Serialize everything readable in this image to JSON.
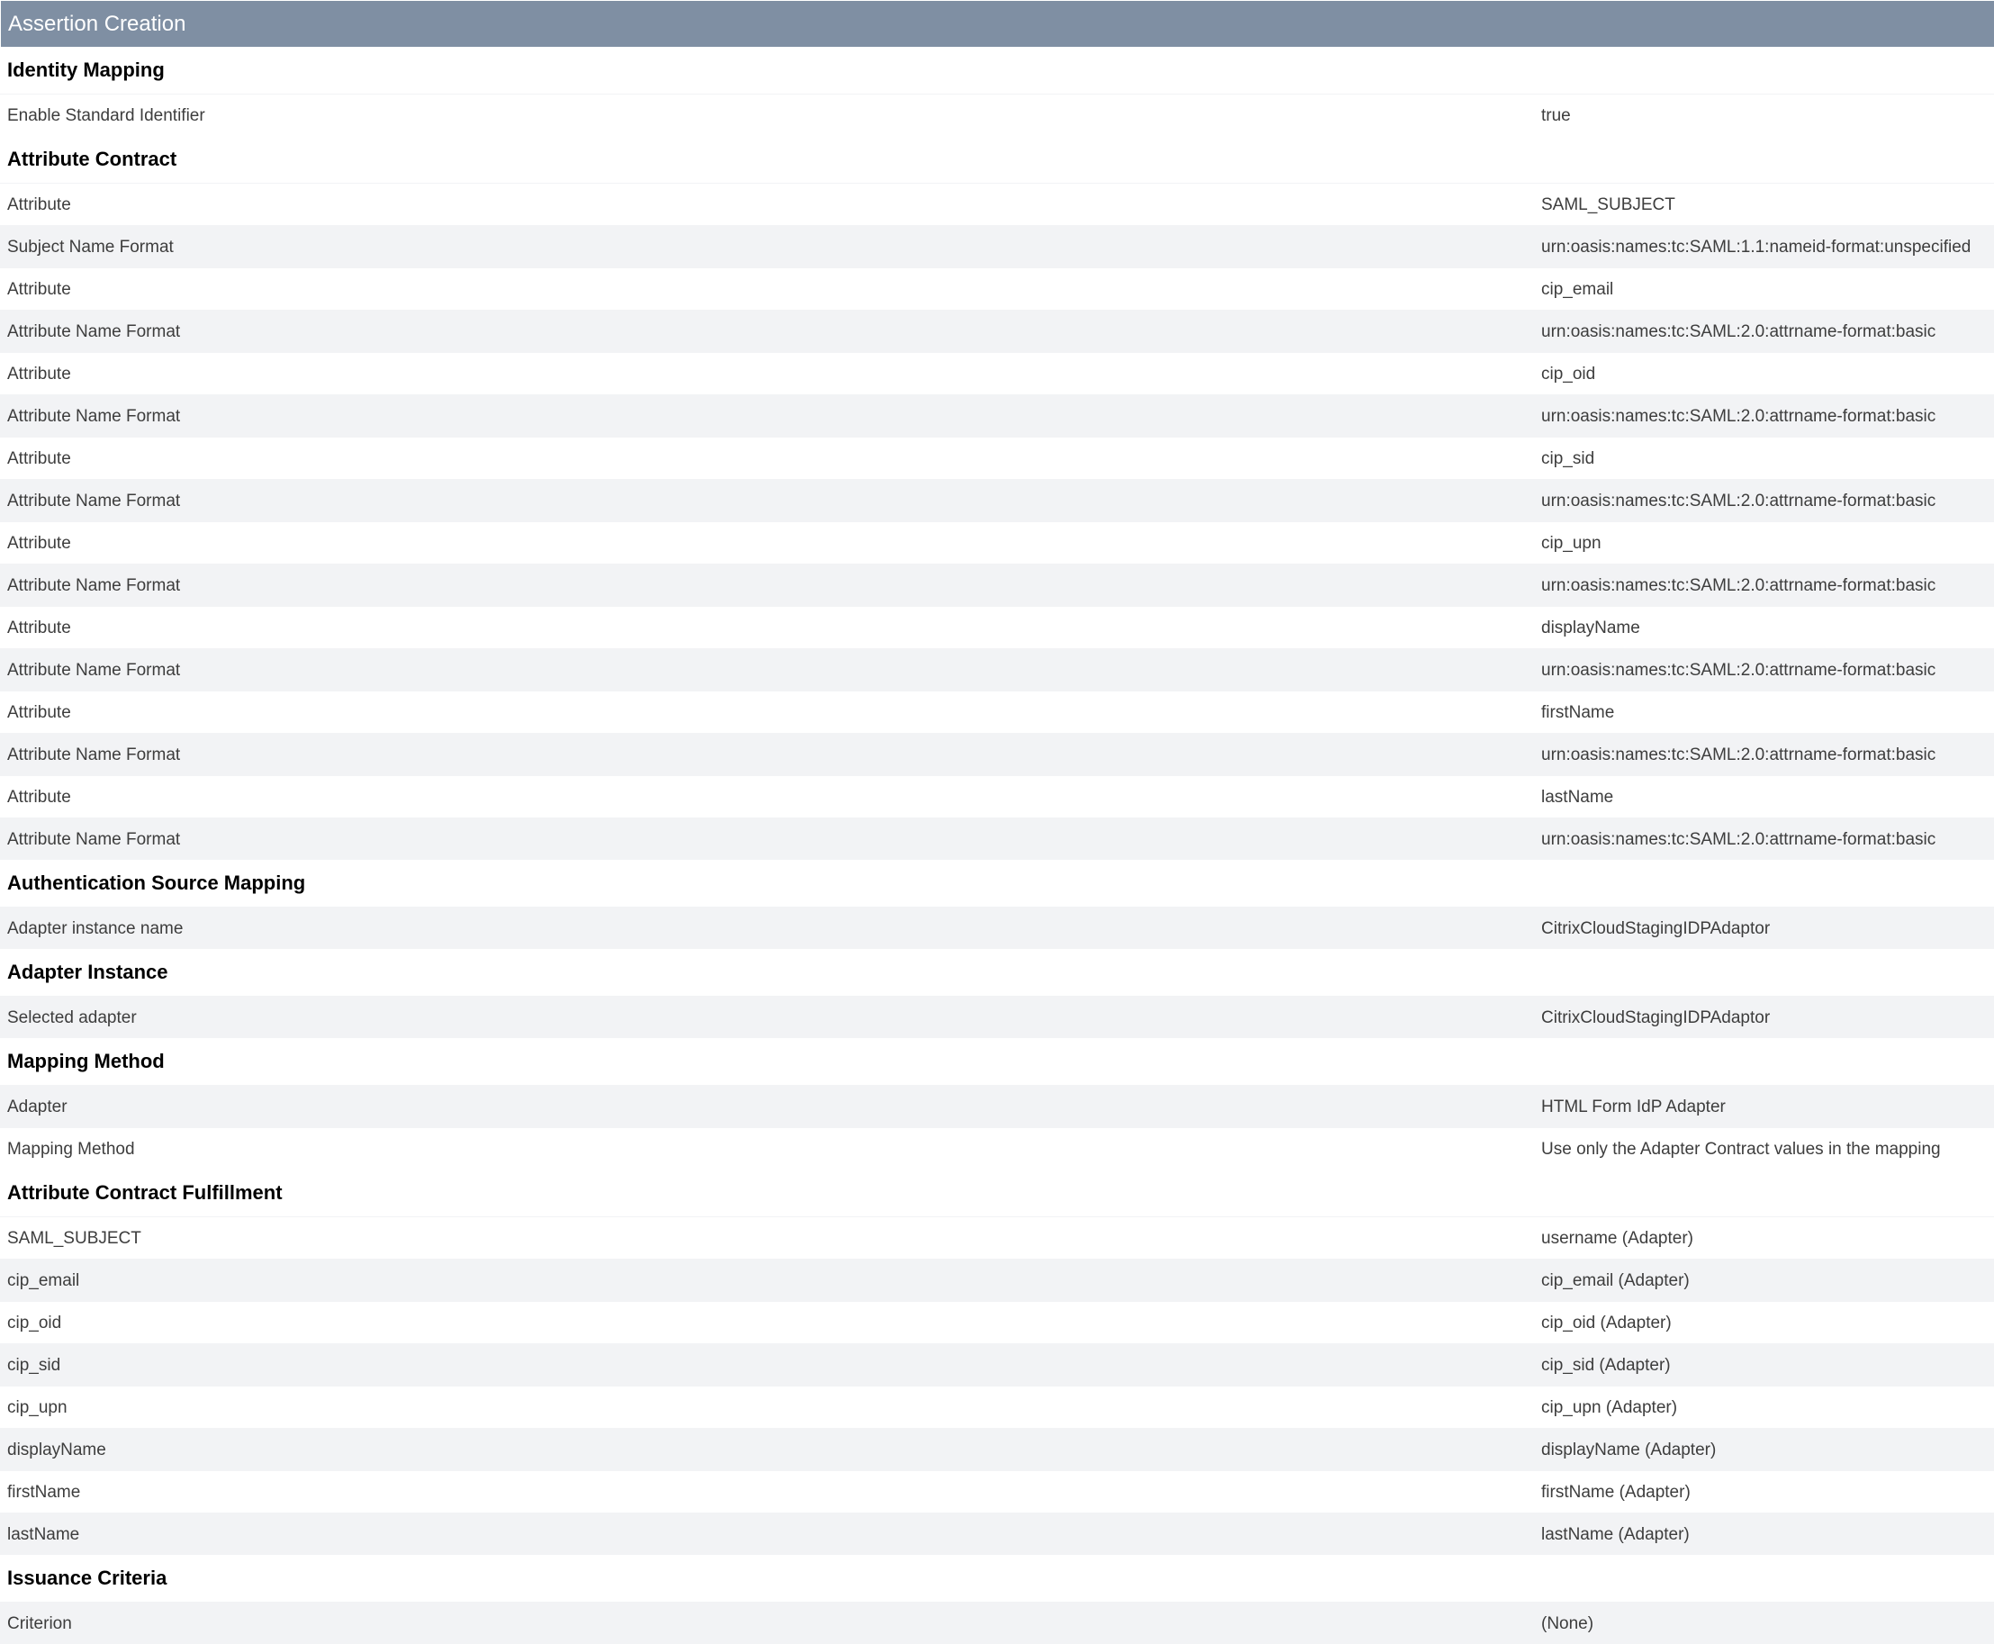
{
  "panel": {
    "title": "Assertion Creation"
  },
  "sections": [
    {
      "title": "Identity Mapping",
      "rows": [
        {
          "label": "Enable Standard Identifier",
          "value": "true"
        }
      ]
    },
    {
      "title": "Attribute Contract",
      "rows": [
        {
          "label": "Attribute",
          "value": "SAML_SUBJECT"
        },
        {
          "label": "Subject Name Format",
          "value": "urn:oasis:names:tc:SAML:1.1:nameid-format:unspecified"
        },
        {
          "label": "Attribute",
          "value": "cip_email"
        },
        {
          "label": "Attribute Name Format",
          "value": "urn:oasis:names:tc:SAML:2.0:attrname-format:basic"
        },
        {
          "label": "Attribute",
          "value": "cip_oid"
        },
        {
          "label": "Attribute Name Format",
          "value": "urn:oasis:names:tc:SAML:2.0:attrname-format:basic"
        },
        {
          "label": "Attribute",
          "value": "cip_sid"
        },
        {
          "label": "Attribute Name Format",
          "value": "urn:oasis:names:tc:SAML:2.0:attrname-format:basic"
        },
        {
          "label": "Attribute",
          "value": "cip_upn"
        },
        {
          "label": "Attribute Name Format",
          "value": "urn:oasis:names:tc:SAML:2.0:attrname-format:basic"
        },
        {
          "label": "Attribute",
          "value": "displayName"
        },
        {
          "label": "Attribute Name Format",
          "value": "urn:oasis:names:tc:SAML:2.0:attrname-format:basic"
        },
        {
          "label": "Attribute",
          "value": "firstName"
        },
        {
          "label": "Attribute Name Format",
          "value": "urn:oasis:names:tc:SAML:2.0:attrname-format:basic"
        },
        {
          "label": "Attribute",
          "value": "lastName"
        },
        {
          "label": "Attribute Name Format",
          "value": "urn:oasis:names:tc:SAML:2.0:attrname-format:basic"
        }
      ]
    },
    {
      "title": "Authentication Source Mapping",
      "rows": [
        {
          "label": "Adapter instance name",
          "value": "CitrixCloudStagingIDPAdaptor"
        }
      ]
    },
    {
      "title": "Adapter Instance",
      "rows": [
        {
          "label": "Selected adapter",
          "value": "CitrixCloudStagingIDPAdaptor"
        }
      ]
    },
    {
      "title": "Mapping Method",
      "rows": [
        {
          "label": "Adapter",
          "value": "HTML Form IdP Adapter"
        },
        {
          "label": "Mapping Method",
          "value": "Use only the Adapter Contract values in the mapping"
        }
      ]
    },
    {
      "title": "Attribute Contract Fulfillment",
      "rows": [
        {
          "label": "SAML_SUBJECT",
          "value": "username (Adapter)"
        },
        {
          "label": "cip_email",
          "value": "cip_email (Adapter)"
        },
        {
          "label": "cip_oid",
          "value": "cip_oid (Adapter)"
        },
        {
          "label": "cip_sid",
          "value": "cip_sid (Adapter)"
        },
        {
          "label": "cip_upn",
          "value": "cip_upn (Adapter)"
        },
        {
          "label": "displayName",
          "value": "displayName (Adapter)"
        },
        {
          "label": "firstName",
          "value": "firstName (Adapter)"
        },
        {
          "label": "lastName",
          "value": "lastName (Adapter)"
        }
      ]
    },
    {
      "title": "Issuance Criteria",
      "rows": [
        {
          "label": "Criterion",
          "value": "(None)"
        }
      ]
    }
  ]
}
